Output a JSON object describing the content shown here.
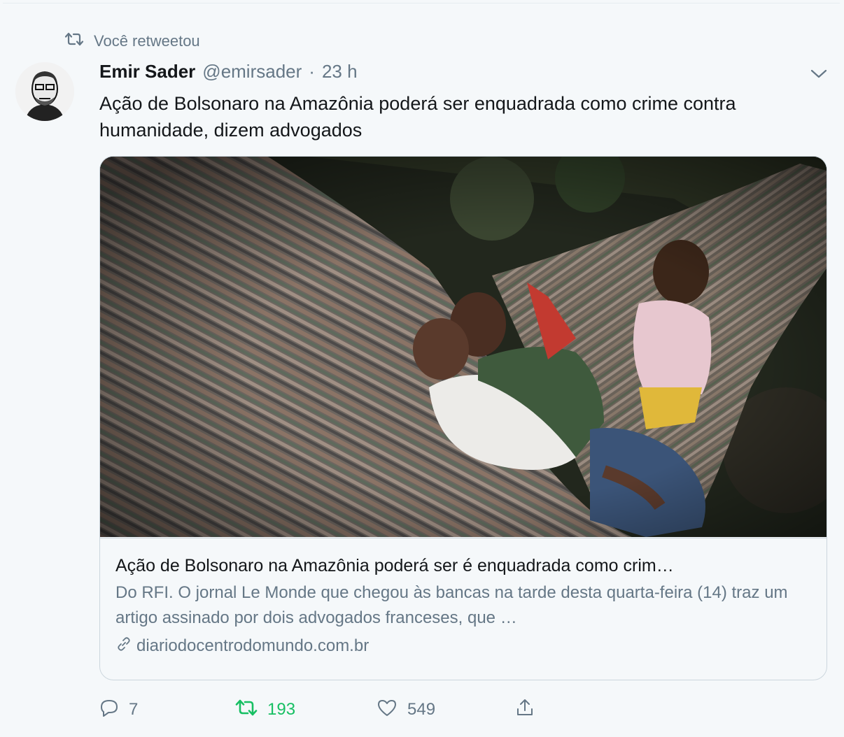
{
  "retweet_context": {
    "label": "Você retweetou",
    "icon": "retweet-icon"
  },
  "author": {
    "name": "Emir Sader",
    "handle": "@emirsader",
    "separator": "·",
    "time": "23 h",
    "avatar": "avatar-portrait"
  },
  "tweet": {
    "text": "Ação de Bolsonaro na Amazônia poderá ser enquadrada como crime contra humanidade, dizem advogados"
  },
  "card": {
    "image": "photo-children-in-hammock",
    "title": "Ação de Bolsonaro na Amazônia poderá ser é enquadrada como crim…",
    "description": "Do RFI. O jornal Le Monde que chegou às bancas na tarde desta quarta-feira (14) traz um artigo assinado por dois advogados franceses, que …",
    "domain": "diariodocentrodomundo.com.br",
    "domain_icon": "link-icon"
  },
  "actions": {
    "reply_count": "7",
    "retweet_count": "193",
    "like_count": "549",
    "retweet_active": true
  },
  "colors": {
    "background": "#f5f8fa",
    "text_primary": "#14171a",
    "text_secondary": "#657786",
    "retweet_active": "#17bf63",
    "border": "#ccd6dd"
  }
}
